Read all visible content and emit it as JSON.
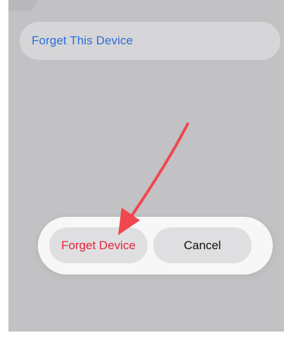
{
  "settings_list": {
    "forget_this_device_label": "Forget This Device"
  },
  "action_sheet": {
    "forget_device_label": "Forget Device",
    "cancel_label": "Cancel"
  },
  "colors": {
    "link_blue": "#2a6ed6",
    "destructive_red": "#e5233d",
    "annotation_arrow": "#f0474f"
  },
  "annotation": {
    "icon": "red-pointer-arrow-icon"
  }
}
